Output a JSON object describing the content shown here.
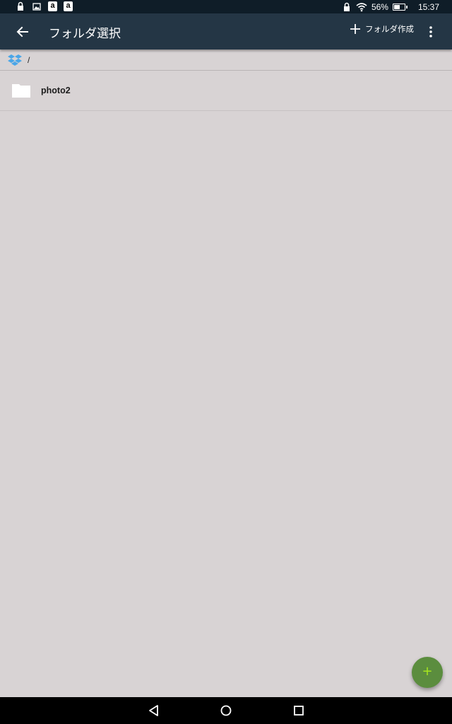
{
  "status_bar": {
    "left_icons": [
      "lock-icon",
      "image-icon",
      "amazon-icon",
      "amazon-icon"
    ],
    "amazon_glyph": "a",
    "battery_percent": "56%",
    "battery_level": 0.56,
    "time": "15:37"
  },
  "app_bar": {
    "title": "フォルダ選択",
    "create_folder_label": "フォルダ作成"
  },
  "breadcrumb": {
    "path": "/"
  },
  "folders": [
    {
      "name": "photo2"
    }
  ],
  "fab": {
    "label": "+"
  },
  "colors": {
    "status_bar_bg": "#0f1d28",
    "app_bar_bg": "#243645",
    "content_bg": "#d8d3d4",
    "fab_bg": "#5b8d3e",
    "fab_plus": "#a6e61e",
    "dropbox_blue": "#4aa6e8"
  }
}
